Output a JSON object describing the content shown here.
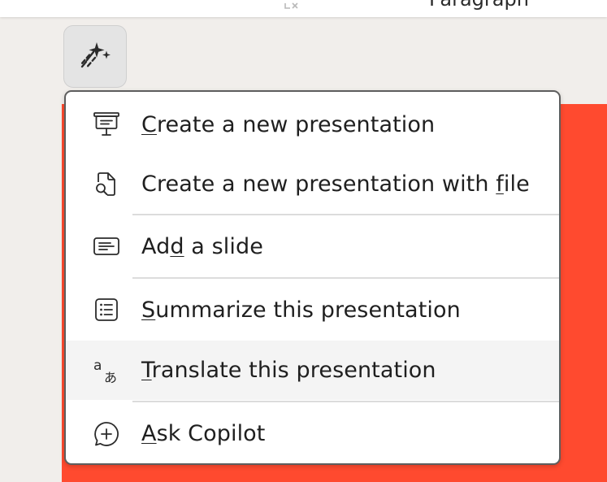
{
  "colors": {
    "page_background": "#f1eeeb",
    "slide_accent": "#ff4a2f",
    "menu_border": "#5e5e5e",
    "hover_background": "#f4f4f4"
  },
  "ribbon": {
    "paragraph_label": "Paragraph"
  },
  "copilot_button": {
    "icon": "copilot-sparkle-icon"
  },
  "menu": {
    "items": [
      {
        "icon": "presentation-board-icon",
        "pre": "",
        "key": "C",
        "post": "reate a new presentation"
      },
      {
        "icon": "document-search-icon",
        "pre": "Create a new presentation with ",
        "key": "f",
        "post": "ile"
      },
      {
        "icon": "slide-add-icon",
        "pre": "Ad",
        "key": "d",
        "post": " a slide"
      },
      {
        "icon": "text-bullet-list-icon",
        "pre": "",
        "key": "S",
        "post": "ummarize this presentation"
      },
      {
        "icon": "translate-icon",
        "pre": "",
        "key": "T",
        "post": "ranslate this presentation"
      },
      {
        "icon": "chat-add-icon",
        "pre": "",
        "key": "A",
        "post": "sk Copilot"
      }
    ],
    "hovered_index": 4
  }
}
